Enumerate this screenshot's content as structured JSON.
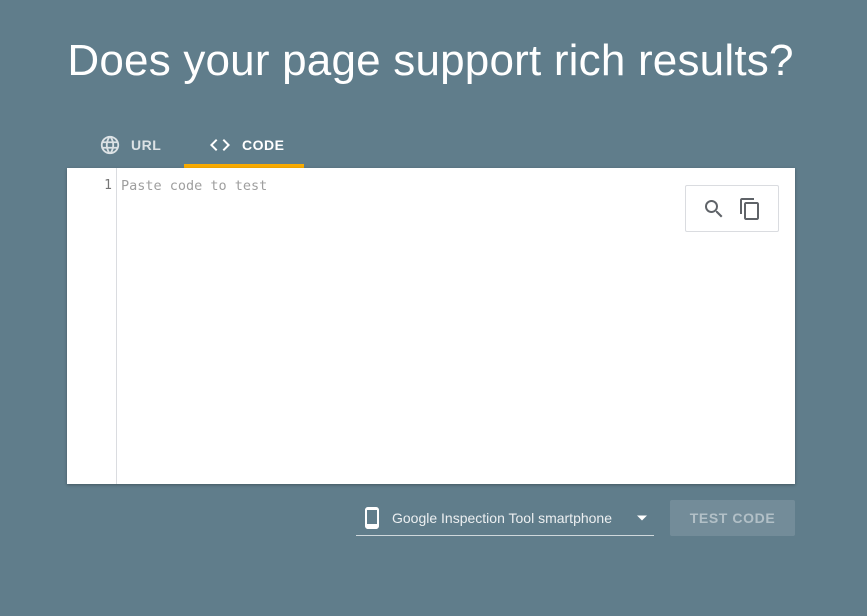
{
  "page": {
    "headline": "Does your page support rich results?"
  },
  "tabs": [
    {
      "label": "URL",
      "icon": "globe-icon",
      "selected": false
    },
    {
      "label": "CODE",
      "icon": "code-icon",
      "selected": true
    }
  ],
  "editor": {
    "line_numbers": [
      "1"
    ],
    "placeholder": "Paste code to test",
    "value": "",
    "tools": [
      {
        "icon": "search-icon"
      },
      {
        "icon": "copy-icon"
      }
    ]
  },
  "device_select": {
    "icon": "smartphone-icon",
    "selected": "Google Inspection Tool smartphone"
  },
  "actions": {
    "test_label": "TEST CODE",
    "test_enabled": false
  },
  "colors": {
    "background": "#607d8b",
    "tab_indicator": "#f9ab00",
    "editor_bg": "#ffffff"
  }
}
